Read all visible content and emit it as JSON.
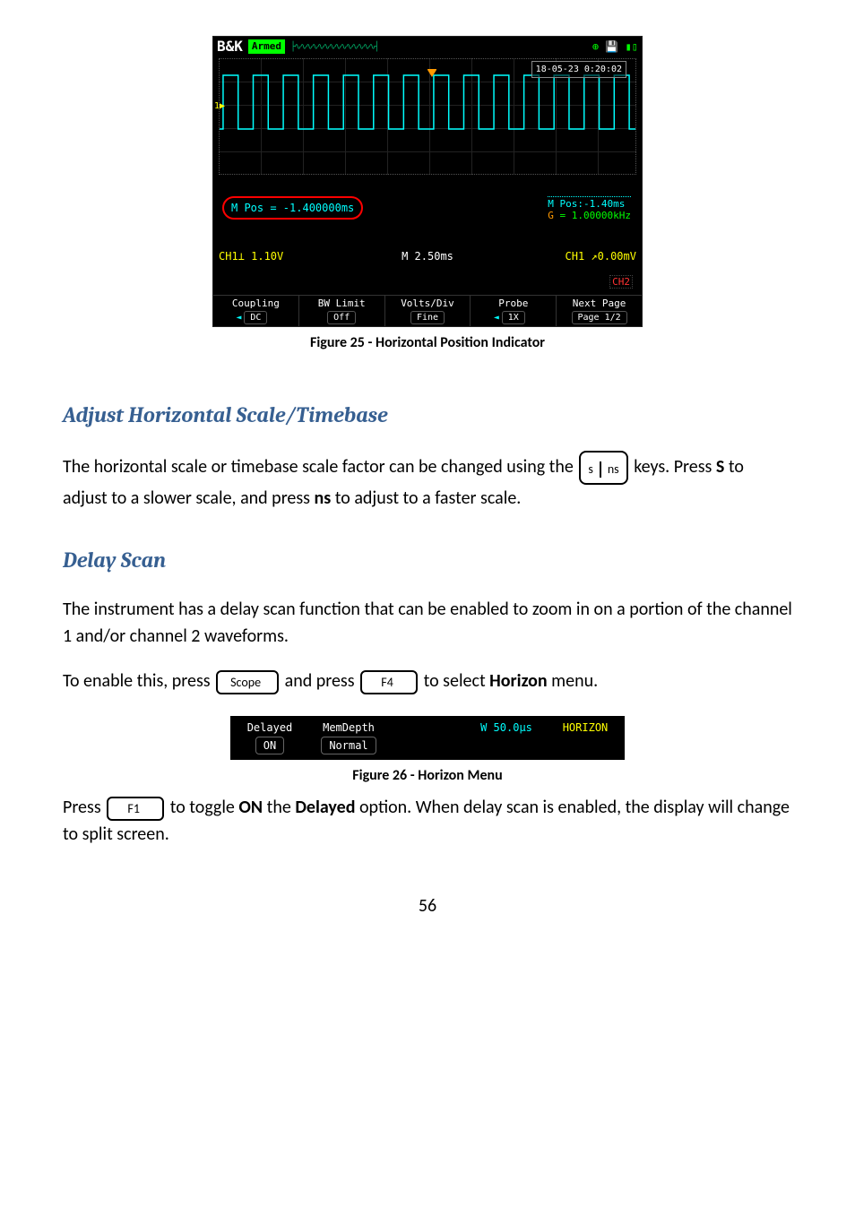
{
  "fig25": {
    "bk": "B&K",
    "armed": "Armed",
    "wave_top": "├∿∿∿∿∿∿∿∿∿∿∿∿∿∿┤",
    "timestamp": "18-05-23 0:20:02",
    "ch1_marker": "1▶",
    "edge": "←T",
    "mpos_label": "M Pos = -1.400000ms",
    "mpos_top": "M Pos:-1.40ms",
    "freq_arrow": "G",
    "freq": " = 1.00000kHz",
    "ch1v": "CH1⟂ 1.10V",
    "mtime": "M 2.50ms",
    "chtrg": "CH1 ↗0.00mV",
    "ch2": "CH2",
    "menu": {
      "coupling": "Coupling",
      "coupling_val": "DC",
      "bwlimit": "BW Limit",
      "bwlimit_val": "Off",
      "voltsdiv": "Volts/Div",
      "voltsdiv_val": "Fine",
      "probe": "Probe",
      "probe_val": "1X",
      "nextpage": "Next Page",
      "nextpage_val": "Page 1/2"
    },
    "caption": "Figure 25 - Horizontal Position Indicator"
  },
  "sections": {
    "adjust_hscale": "Adjust Horizontal Scale/Timebase",
    "delay_scan": "Delay Scan"
  },
  "para": {
    "p1a": "The horizontal scale or timebase scale factor can be changed using the ",
    "p1b": " keys.  Press ",
    "p1c": " to adjust to a slower scale, and press ",
    "p1d": " to adjust to a faster scale.",
    "p2": "The instrument has a delay scan function that can be enabled to zoom in on a portion of the channel 1 and/or channel 2 waveforms.",
    "p3a": "To enable this, press ",
    "p3b": " and press ",
    "p3c": " to select ",
    "p3d": " menu.",
    "p4a": "Press ",
    "p4b": " to toggle ",
    "p4c": " the ",
    "p4d": " option.  When delay scan is enabled, the display will change to split screen."
  },
  "keys": {
    "s": "s",
    "ns": "ns",
    "S": "S",
    "ns_bold": "ns",
    "scope": "Scope",
    "f4": "F4",
    "f1": "F1",
    "on": "ON",
    "delayed": "Delayed",
    "horizon": "Horizon"
  },
  "fig26": {
    "delayed": "Delayed",
    "on": "ON",
    "memdepth": "MemDepth",
    "normal": "Normal",
    "wtime": "W 50.0µs",
    "title": "HORIZON",
    "caption": "Figure 26 - Horizon Menu"
  },
  "page_num": "56"
}
